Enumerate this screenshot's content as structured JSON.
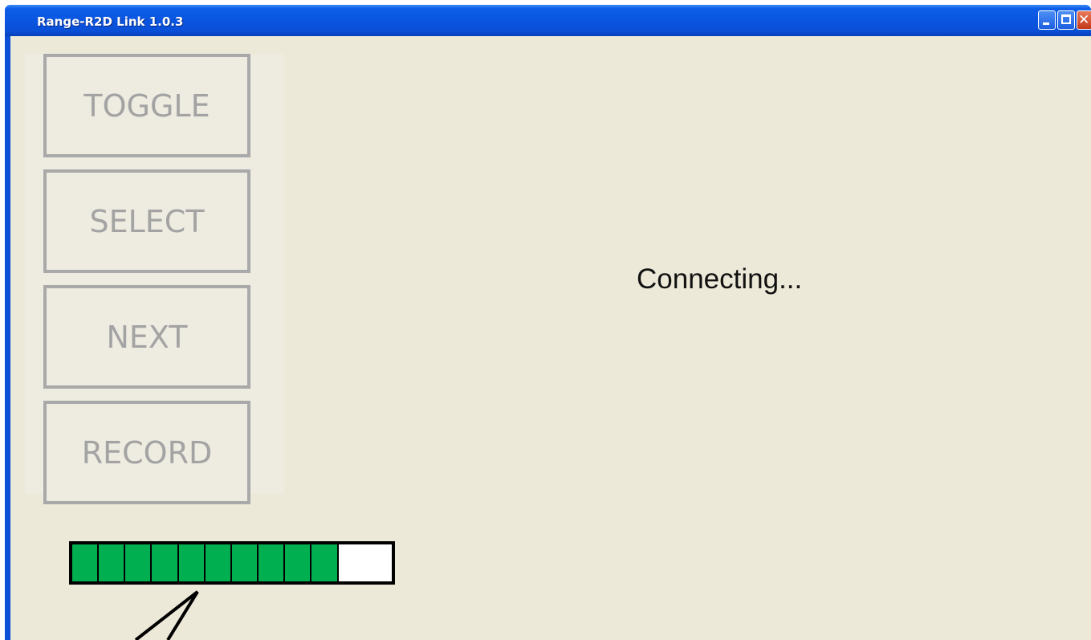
{
  "window": {
    "title": "Range-R2D Link 1.0.3",
    "minimize_icon": "minimize-icon",
    "maximize_icon": "maximize-icon",
    "close_icon": "close-icon",
    "close_glyph": "✕"
  },
  "buttons": [
    {
      "label": "TOGGLE"
    },
    {
      "label": "SELECT"
    },
    {
      "label": "NEXT"
    },
    {
      "label": "RECORD"
    }
  ],
  "status": {
    "text": "Connecting..."
  },
  "progress": {
    "segments_total": 12,
    "segments_filled": 10,
    "fill_color": "#00b050",
    "border_color": "#000000"
  },
  "colors": {
    "client_bg": "#ece9d8",
    "button_border": "#a9a9a9",
    "button_text": "#a3a3a3",
    "titlebar": "#0a4fd6"
  }
}
